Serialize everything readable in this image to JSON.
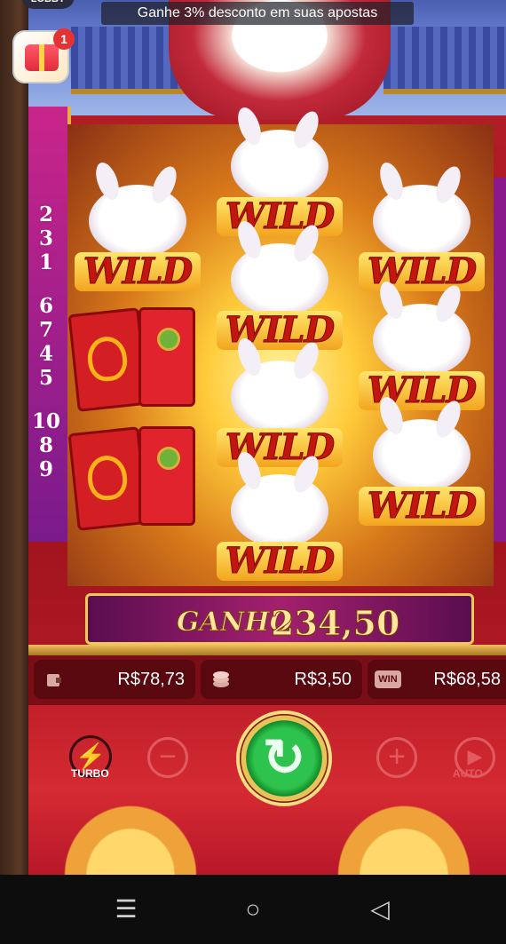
{
  "lobby_label": "LOBBY",
  "toast": "Ganhe 3% desconto em suas apostas",
  "promo": {
    "badge_count": "1"
  },
  "multipliers": {
    "group1": [
      "2",
      "3",
      "1"
    ],
    "group2": [
      "6",
      "7",
      "4",
      "5"
    ],
    "group3": [
      "10",
      "8",
      "9"
    ]
  },
  "reels": {
    "wild_label": "WILD",
    "symbols": [
      {
        "type": "wild"
      },
      {
        "type": "wild"
      },
      {
        "type": "wild"
      },
      {
        "type": "envelope"
      },
      {
        "type": "wild"
      },
      {
        "type": "wild"
      },
      {
        "type": "envelope"
      },
      {
        "type": "wild"
      },
      {
        "type": "wild"
      },
      {
        "type": "wild"
      }
    ]
  },
  "win": {
    "label": "GANHO",
    "amount": "234,50"
  },
  "stats": {
    "balance": "R$78,73",
    "bet": "R$3,50",
    "win": "R$68,58",
    "win_icon_label": "WIN"
  },
  "controls": {
    "turbo_label": "TURBO",
    "auto_label": "AUTO",
    "minus_symbol": "−",
    "plus_symbol": "+",
    "spin_icon": "refresh-icon"
  },
  "icons": {
    "wallet": "wallet-icon",
    "coins": "coins-icon",
    "win": "win-badge-icon",
    "lightning": "lightning-icon",
    "play": "play-icon",
    "nav_menu": "menu-icon",
    "nav_home": "home-icon",
    "nav_back": "back-icon"
  },
  "colors": {
    "game_bg": "#b81e2a",
    "gold": "#f0c85a",
    "spin_green": "#2ec34c",
    "wild_text": "#c2160e"
  }
}
